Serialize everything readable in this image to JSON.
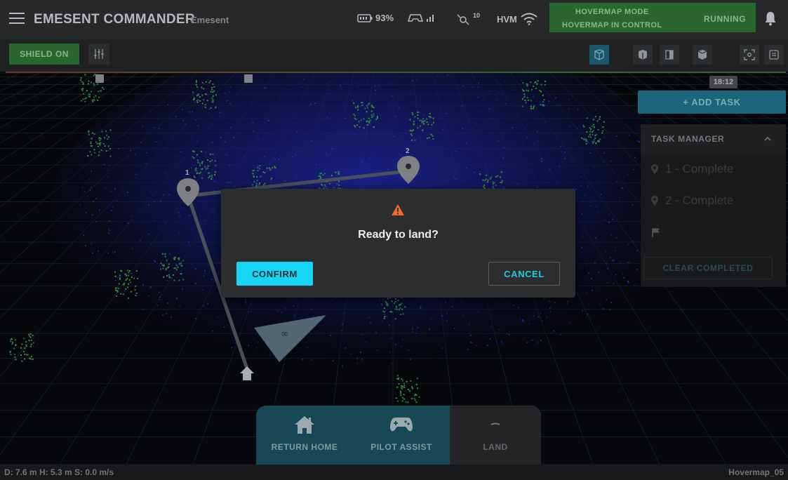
{
  "header": {
    "app_title": "EMESENT COMMANDER",
    "app_subtitle": "Emesent",
    "battery": "93%",
    "sat_count": "10",
    "hvm_label": "HVM",
    "mode_line1": "HOVERMAP MODE",
    "mode_line2": "HOVERMAP IN CONTROL",
    "mode_status": "RUNNING",
    "mode_color": "#2e6f35"
  },
  "toolbar": {
    "shield_label": "SHIELD ON",
    "view_buttons": [
      "perspective-view",
      "front-view",
      "side-view",
      "top-view",
      "fit-view",
      "map-view"
    ]
  },
  "map": {
    "time": "18:12",
    "waypoint_1": "1",
    "waypoint_2": "2"
  },
  "tasks": {
    "add_label": "+ ADD TASK",
    "panel_title": "TASK MANAGER",
    "items": [
      "1 - Complete",
      "2 - Complete"
    ],
    "clear_label": "CLEAR COMPLETED"
  },
  "dialog": {
    "title": "Ready to land?",
    "confirm": "CONFIRM",
    "cancel": "CANCEL",
    "accent": "#17d6f5",
    "warn_color": "#f36b21"
  },
  "bottom": {
    "return_home": "RETURN HOME",
    "pilot_assist": "PILOT ASSIST",
    "land": "LAND"
  },
  "status": {
    "telemetry": "D: 7.6 m  H: 5.3 m  S: 0.0 m/s",
    "device": "Hovermap_05"
  }
}
